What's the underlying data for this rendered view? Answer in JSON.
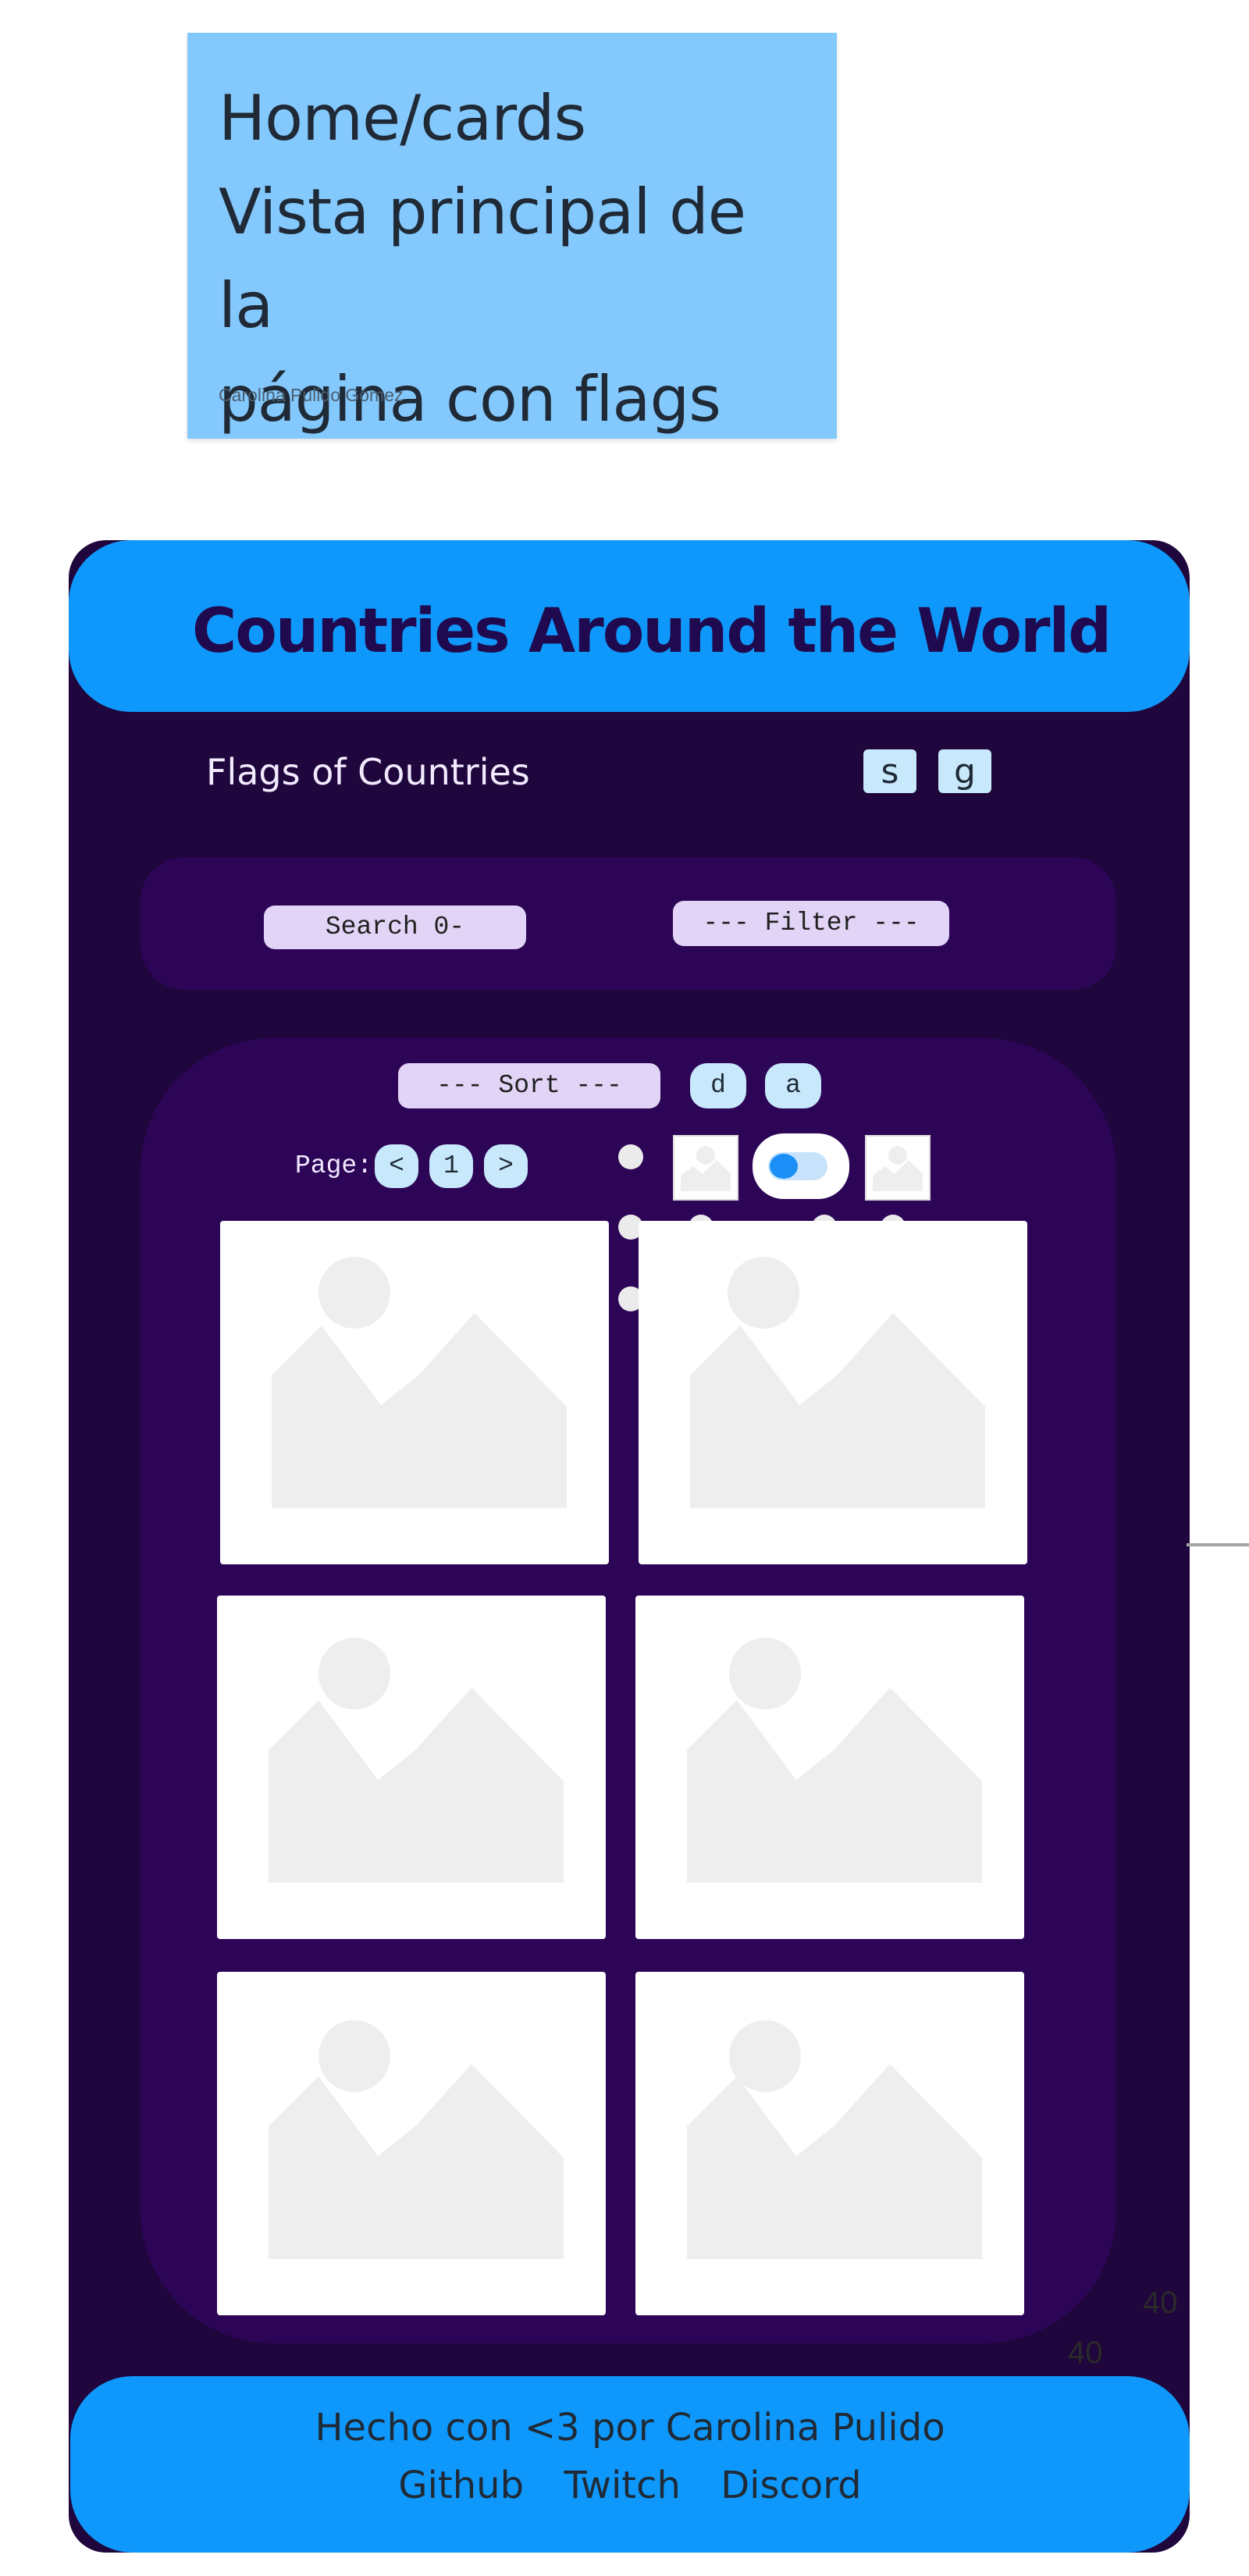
{
  "note": {
    "title_line1": "Home/cards",
    "title_line2": "Vista principal de la",
    "title_line3": "página con flags",
    "author": "Carolina Pulido Gómez"
  },
  "header": {
    "title": "Countries Around the World"
  },
  "subheader": {
    "title": "Flags of Countries",
    "btn_s": "s",
    "btn_g": "g"
  },
  "controls": {
    "search_label": "Search 0-",
    "filter_label": "--- Filter ---",
    "sort_label": "--- Sort ---",
    "sort_desc": "d",
    "sort_asc": "a",
    "page_label": "Page:",
    "prev": "<",
    "page_number": "1",
    "next": ">"
  },
  "cards": [
    {
      "image": "image-placeholder-icon"
    },
    {
      "image": "image-placeholder-icon"
    },
    {
      "image": "image-placeholder-icon"
    },
    {
      "image": "image-placeholder-icon"
    },
    {
      "image": "image-placeholder-icon"
    },
    {
      "image": "image-placeholder-icon"
    }
  ],
  "side_numbers": [
    "40",
    "40"
  ],
  "footer": {
    "text": "Hecho con <3 por Carolina Pulido",
    "links": [
      "Github",
      "Twitch",
      "Discord"
    ]
  },
  "colors": {
    "accent": "#0f98fb",
    "background": "#1f063c",
    "panel": "#2d0557",
    "button": "#c8e8fc",
    "pill": "#e2d4f6",
    "note": "#84c9fd"
  }
}
